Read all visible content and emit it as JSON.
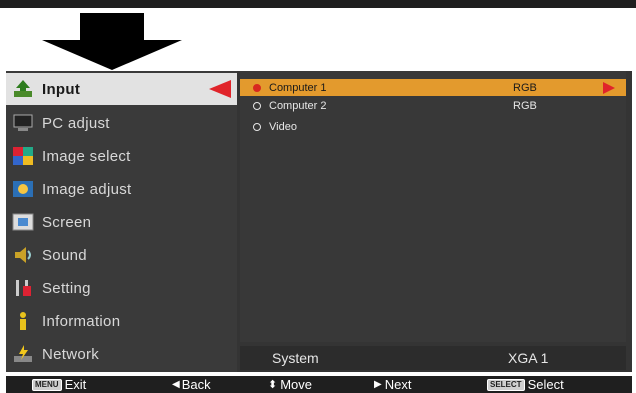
{
  "sidebar": {
    "items": [
      {
        "label": "Input",
        "icon": "input-icon",
        "active": true
      },
      {
        "label": "PC adjust",
        "icon": "pc-adjust-icon"
      },
      {
        "label": "Image select",
        "icon": "image-select-icon"
      },
      {
        "label": "Image adjust",
        "icon": "image-adjust-icon"
      },
      {
        "label": "Screen",
        "icon": "screen-icon"
      },
      {
        "label": "Sound",
        "icon": "sound-icon"
      },
      {
        "label": "Setting",
        "icon": "setting-icon"
      },
      {
        "label": "Information",
        "icon": "information-icon"
      },
      {
        "label": "Network",
        "icon": "network-icon"
      }
    ]
  },
  "inputs": {
    "rows": [
      {
        "name": "Computer 1",
        "signal": "RGB",
        "selected": true
      },
      {
        "name": "Computer 2",
        "signal": "RGB"
      },
      {
        "name": "Video",
        "signal": ""
      }
    ]
  },
  "status": {
    "label": "System",
    "value": "XGA 1"
  },
  "footer": {
    "exit_key": "MENU",
    "exit": "Exit",
    "back": "Back",
    "move": "Move",
    "next": "Next",
    "select_key": "SELECT",
    "select": "Select"
  },
  "colors": {
    "accent": "#e39a2d",
    "pointer": "#e0242a",
    "menu_bg": "#3a3a3a"
  }
}
